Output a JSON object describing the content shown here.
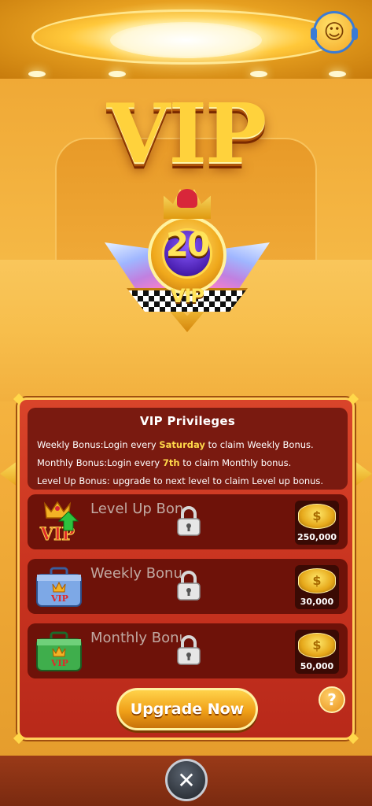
{
  "header": {
    "title": "VIP",
    "support_icon": "headset-smiley-icon"
  },
  "badge": {
    "level": "20",
    "label": "VIP"
  },
  "privileges": {
    "title": "VIP  Privileges",
    "weekly": {
      "prefix": "Weekly Bonus:Login every ",
      "highlight": "Saturday",
      "suffix": " to claim Weekly Bonus."
    },
    "monthly": {
      "prefix": "Monthly Bonus:Login every ",
      "highlight": "7th",
      "suffix": " to claim Monthly bonus."
    },
    "levelup": "Level Up Bonus: upgrade to next level to claim Level up bonus."
  },
  "bonuses": [
    {
      "label": "Level Up Bonus",
      "amount": "250,000",
      "locked": true,
      "icon": "vip-level-up-icon"
    },
    {
      "label": "Weekly Bonus",
      "amount": "30,000",
      "locked": true,
      "icon": "blue-briefcase-icon"
    },
    {
      "label": "Monthly Bonus",
      "amount": "50,000",
      "locked": true,
      "icon": "green-briefcase-icon"
    }
  ],
  "upgrade_button": "Upgrade Now",
  "help_button": "?",
  "close_button": "✕",
  "colors": {
    "panel": "#c93420",
    "accent_gold": "#ffd84a",
    "highlight_text": "#ffd84a"
  }
}
